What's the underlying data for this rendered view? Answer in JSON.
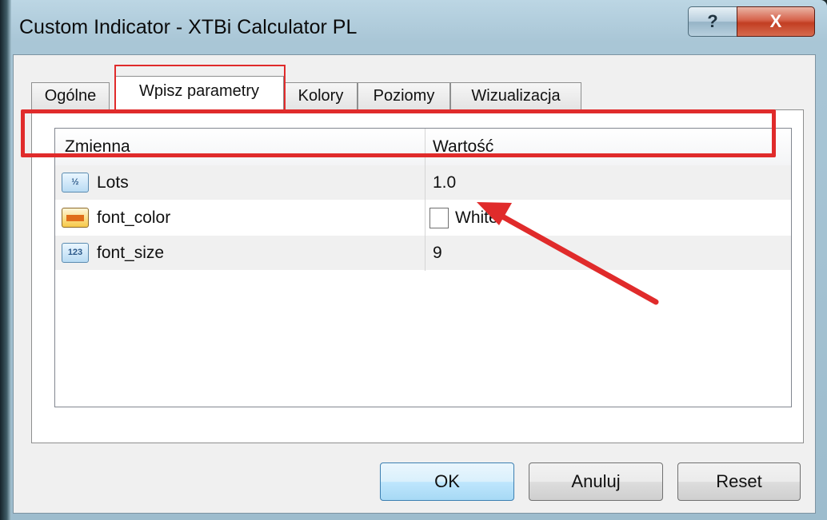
{
  "window": {
    "title": "Custom Indicator - XTBi Calculator PL",
    "help_label": "?",
    "close_label": "X"
  },
  "tabs": [
    {
      "label": "Ogólne",
      "active": false
    },
    {
      "label": "Wpisz parametry",
      "active": true
    },
    {
      "label": "Kolory",
      "active": false
    },
    {
      "label": "Poziomy",
      "active": false
    },
    {
      "label": "Wizualizacja",
      "active": false
    }
  ],
  "grid": {
    "columns": [
      "Zmienna",
      "Wartość"
    ],
    "rows": [
      {
        "icon": "fraction-icon",
        "icon_text": "½",
        "name": "Lots",
        "value": "1.0"
      },
      {
        "icon": "color-icon",
        "icon_text": "",
        "name": "font_color",
        "value": "White",
        "swatch_color": "#ffffff"
      },
      {
        "icon": "integer-icon",
        "icon_text": "123",
        "name": "font_size",
        "value": "9"
      }
    ]
  },
  "buttons": {
    "ok": "OK",
    "cancel": "Anuluj",
    "reset": "Reset"
  },
  "annotations": {
    "highlight_color": "#e02b2b"
  }
}
